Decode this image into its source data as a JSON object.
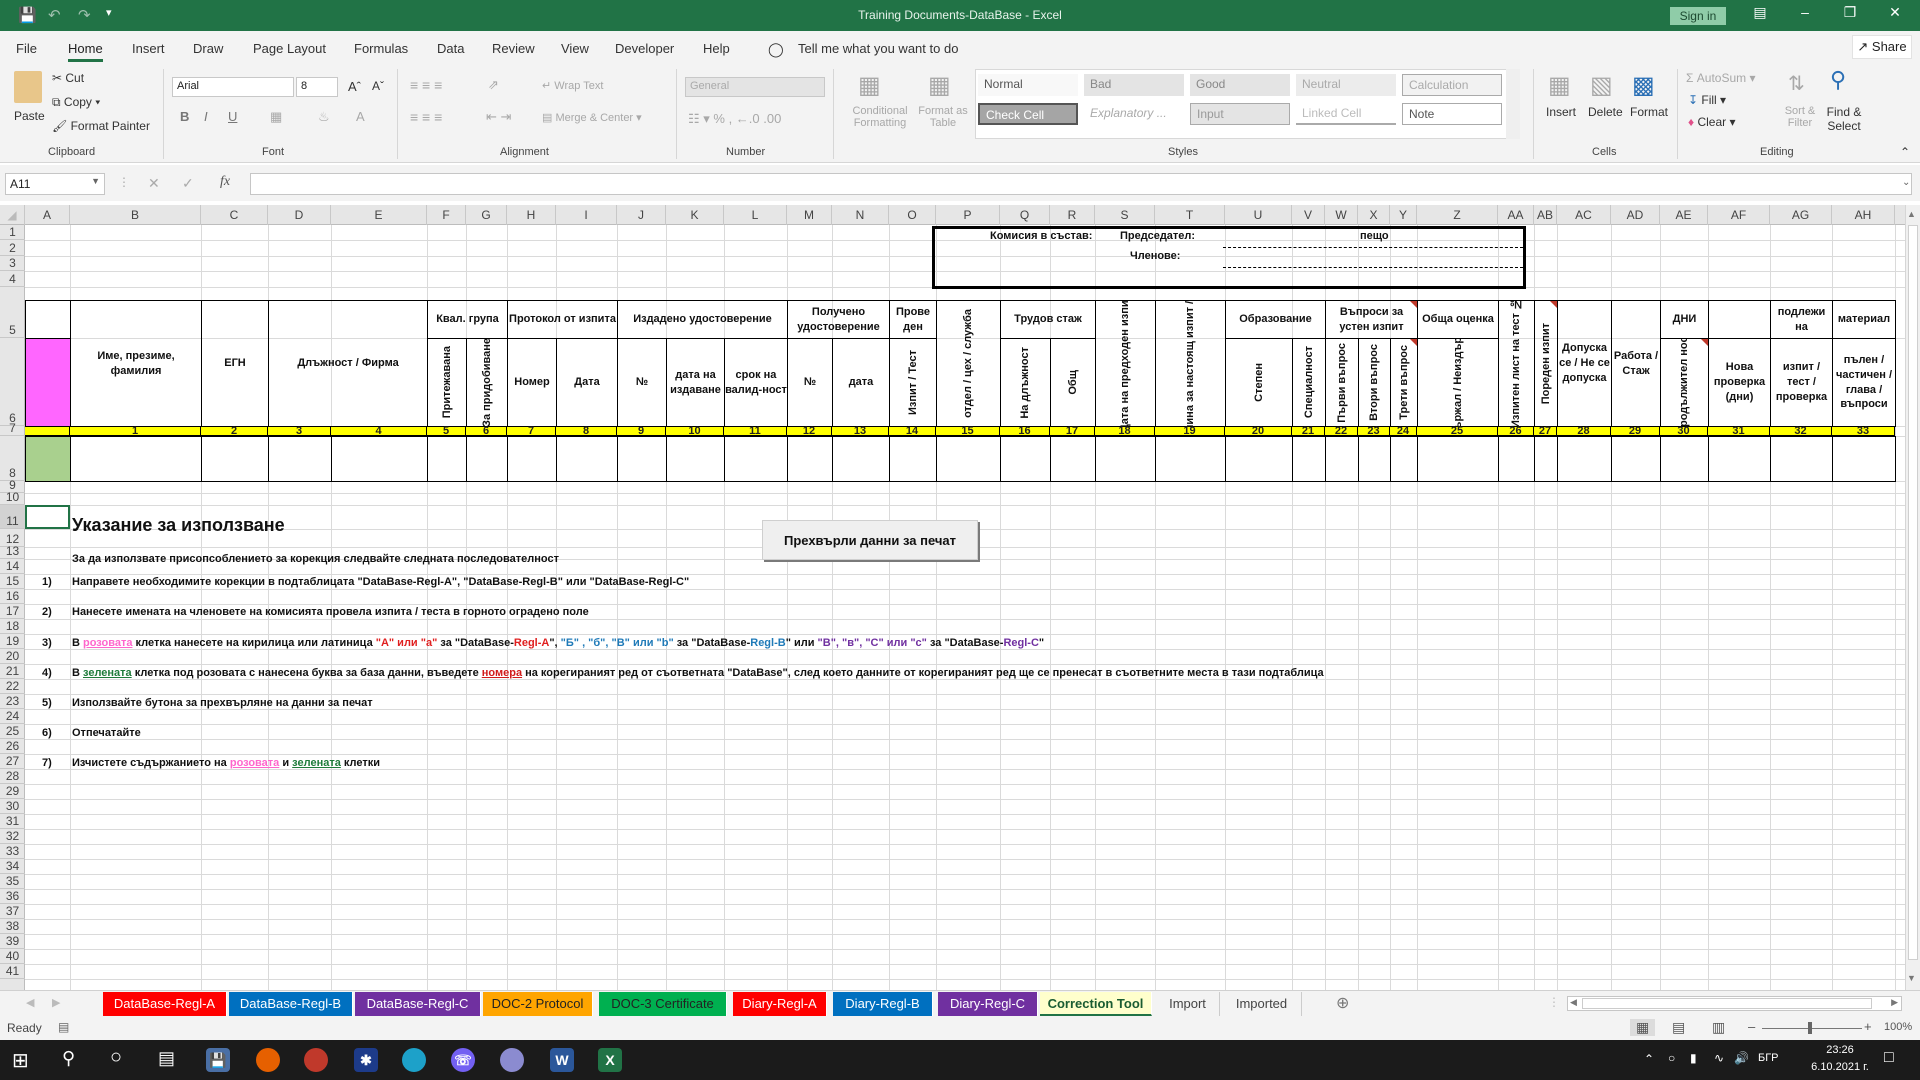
{
  "window": {
    "title": "Training Documents-DataBase  -  Excel",
    "sign_in": "Sign in",
    "controls": [
      "ribbon-display",
      "minimize",
      "restore",
      "close"
    ]
  },
  "menu": {
    "items": [
      "File",
      "Home",
      "Insert",
      "Draw",
      "Page Layout",
      "Formulas",
      "Data",
      "Review",
      "View",
      "Developer",
      "Help"
    ],
    "active": "Home",
    "tell_me": "Tell me what you want to do",
    "share": "Share"
  },
  "ribbon": {
    "clipboard": {
      "paste": "Paste",
      "cut": "Cut",
      "copy": "Copy",
      "format_painter": "Format Painter",
      "label": "Clipboard"
    },
    "font": {
      "name": "Arial",
      "size": "8",
      "label": "Font",
      "bold": "B",
      "italic": "I",
      "underline": "U"
    },
    "alignment": {
      "wrap_text": "Wrap Text",
      "merge_center": "Merge & Center",
      "label": "Alignment"
    },
    "number": {
      "format": "General",
      "label": "Number"
    },
    "styles": {
      "conditional_formatting": "Conditional Formatting",
      "format_as_table": "Format as Table",
      "cells": [
        "Normal",
        "Bad",
        "Good",
        "Neutral",
        "Calculation",
        "Check Cell",
        "Explanatory ...",
        "Input",
        "Linked Cell",
        "Note"
      ],
      "label": "Styles"
    },
    "cells": {
      "insert": "Insert",
      "delete": "Delete",
      "format": "Format",
      "label": "Cells"
    },
    "editing": {
      "autosum": "AutoSum",
      "fill": "Fill",
      "clear": "Clear",
      "sort_filter": "Sort & Filter",
      "find_select": "Find & Select",
      "label": "Editing"
    }
  },
  "formula_bar": {
    "name_box": "A11",
    "formula": ""
  },
  "columns": [
    "A",
    "B",
    "C",
    "D",
    "E",
    "F",
    "G",
    "H",
    "I",
    "J",
    "K",
    "L",
    "M",
    "N",
    "O",
    "P",
    "Q",
    "R",
    "S",
    "T",
    "U",
    "V",
    "W",
    "X",
    "Y",
    "Z",
    "AA",
    "AB",
    "AC",
    "AD",
    "AE",
    "AF",
    "AG",
    "AH"
  ],
  "rows": [
    1,
    2,
    3,
    4,
    5,
    6,
    7,
    8,
    9,
    10,
    11,
    12,
    13,
    14,
    15,
    16,
    17,
    18,
    19,
    20,
    21,
    22,
    23,
    24,
    25,
    26,
    27,
    28,
    29,
    30,
    31,
    32,
    33,
    34,
    35,
    36,
    37,
    38,
    39,
    40,
    41
  ],
  "commission": {
    "label": "Комисия в състав:",
    "chairman_label": "Председател:",
    "chairman_value": "пещо",
    "members_label": "Членове:"
  },
  "table_headers": {
    "name": "Име, презиме, фамилия",
    "egn": "ЕГН",
    "position": "Длъжност / Фирма",
    "qual_group": "Квал. група",
    "qual_owned": "Притежавана",
    "qual_acquire": "За придобиване",
    "protocol": "Протокол от изпита",
    "protocol_number": "Номер",
    "protocol_date": "Дата",
    "issued_cert": "Издадено удостоверение",
    "issued_no": "№",
    "issued_date": "дата на издаване",
    "issued_validity": "срок на валид-ност",
    "received_cert": "Получено удостоверение",
    "received_no": "№",
    "received_date": "дата",
    "conducted": "Прове ден",
    "exam_test": "Изпит / Тест",
    "department": "отдел / цех / служба",
    "work_exp": "Трудов стаж",
    "exp_position": "На длъжност",
    "exp_total": "Общ",
    "prev_exam_date": "Дата на предходен изпит",
    "reason": "Причина за настоящ изпит / тест",
    "education": "Образование",
    "edu_degree": "Степен",
    "edu_specialty": "Специалност",
    "oral_questions": "Въпроси за устен изпит",
    "q1": "Първи въпрос",
    "q2": "Втори въпрос",
    "q3": "Трети въпрос",
    "overall": "Обща оценка",
    "passed": "Издържал / Неиздържал",
    "exam_sheet": "Изпитен лист на тест №",
    "exam_seq": "Пореден изпит",
    "admitted": "Допуска се / Не се допуска",
    "work": "Работа / Стаж",
    "days": "ДНИ",
    "duration": "Продължител ност",
    "new_check": "Нова проверка (дни)",
    "subject_to": "подлежи на",
    "subject_exam": "изпит / тест / проверка",
    "material": "материал",
    "material_detail": "пълен / частичен / глава / въпроси"
  },
  "column_numbers": [
    "1",
    "2",
    "3",
    "4",
    "5",
    "6",
    "7",
    "8",
    "9",
    "10",
    "11",
    "12",
    "13",
    "14",
    "15",
    "16",
    "17",
    "18",
    "19",
    "20",
    "21",
    "22",
    "23",
    "24",
    "25",
    "26",
    "27",
    "28",
    "29",
    "30",
    "31",
    "32",
    "33"
  ],
  "instructions": {
    "title": "Указание за използване",
    "intro": "За да използвате присопсоблението за корекция следвайте следната последователност",
    "button": "Прехвърли данни за печат",
    "steps": [
      {
        "num": "1)",
        "text": "Направете необходимите корекции в подтаблицата \"DataBase-Regl-A\", \"DataBase-Regl-B\" или \"DataBase-Regl-C\""
      },
      {
        "num": "2)",
        "text": "Нанесете имената на членовете на комисията провела изпита / теста в горното оградено поле"
      },
      {
        "num": "3)",
        "parts": [
          "В ",
          "розовата",
          " клетка нанесете на кирилица или латиница ",
          "\"А\"  или \"а\"",
          " за  \"DataBase-",
          "Regl-A",
          "\", ",
          "\"Б\" , \"б\", \"B\" или \"b\"",
          " за  \"DataBase-",
          "Regl-B",
          "\"  или ",
          "\"В\",  \"в\", \"C\"  или \"c\"",
          " за \"DataBase-",
          "Regl-C",
          "\""
        ]
      },
      {
        "num": "4)",
        "parts": [
          "В ",
          "зелената",
          " клетка под  розовата с нанесена буква за база данни,  въведете ",
          "номера",
          " на корегираният ред от съответната \"DataBase\", след което данните от корегираният ред ще се пренесат в съответните места в тази подтаблица"
        ]
      },
      {
        "num": "5)",
        "text": "Използвайте бутона за прехвърляне на данни за печат"
      },
      {
        "num": "6)",
        "text": "Отпечатайте"
      },
      {
        "num": "7)",
        "parts": [
          "Изчистете съдържанието на ",
          "розовата",
          " и ",
          "зелената",
          " клетки"
        ]
      }
    ]
  },
  "sheet_tabs": [
    {
      "label": "DataBase-Regl-A",
      "color": "#ff0000"
    },
    {
      "label": "DataBase-Regl-B",
      "color": "#0070c0"
    },
    {
      "label": "DataBase-Regl-C",
      "color": "#7030a0"
    },
    {
      "label": "DOC-2 Protocol",
      "color": "#ffa500"
    },
    {
      "label": "DOC-3 Certificate",
      "color": "#00b050"
    },
    {
      "label": "Diary-Regl-A",
      "color": "#ff0000"
    },
    {
      "label": "Diary-Regl-B",
      "color": "#0070c0"
    },
    {
      "label": "Diary-Regl-C",
      "color": "#7030a0"
    },
    {
      "label": "Correction Tool",
      "color": "#ffffcc",
      "active": true
    },
    {
      "label": "Import",
      "color": ""
    },
    {
      "label": "Imported",
      "color": ""
    }
  ],
  "status": {
    "ready": "Ready",
    "zoom": "100%"
  },
  "taskbar": {
    "language": "БГР",
    "time": "23:26",
    "date": "6.10.2021 г."
  },
  "colors": {
    "excel_green": "#217346",
    "pink_cell": "#ff66ff",
    "green_cell": "#a9d08e",
    "yellow_row": "#ffff00"
  }
}
